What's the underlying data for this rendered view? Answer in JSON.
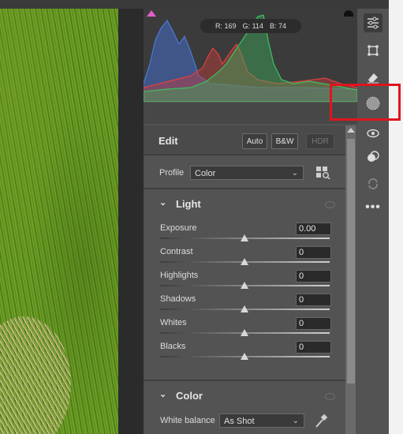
{
  "histogram": {
    "r_label": "R:",
    "r_value": "169",
    "g_label": "G:",
    "g_value": "114",
    "b_label": "B:",
    "b_value": "74"
  },
  "edit": {
    "title": "Edit",
    "auto_label": "Auto",
    "bw_label": "B&W",
    "hdr_label": "HDR"
  },
  "profile": {
    "label": "Profile",
    "value": "Color"
  },
  "light": {
    "title": "Light",
    "sliders": [
      {
        "label": "Exposure",
        "value": "0.00"
      },
      {
        "label": "Contrast",
        "value": "0"
      },
      {
        "label": "Highlights",
        "value": "0"
      },
      {
        "label": "Shadows",
        "value": "0"
      },
      {
        "label": "Whites",
        "value": "0"
      },
      {
        "label": "Blacks",
        "value": "0"
      }
    ]
  },
  "color": {
    "title": "Color",
    "wb_label": "White balance",
    "wb_value": "As Shot"
  },
  "toolbar": {
    "icons": [
      "edit-sliders-icon",
      "crop-icon",
      "healing-eraser-icon",
      "masking-icon",
      "red-eye-icon",
      "presets-icon",
      "snapshots-icon",
      "more-icon"
    ]
  },
  "colors": {
    "panel": "#535353",
    "histogram_bg": "#3b3b3b",
    "highlight": "#e0141e"
  }
}
